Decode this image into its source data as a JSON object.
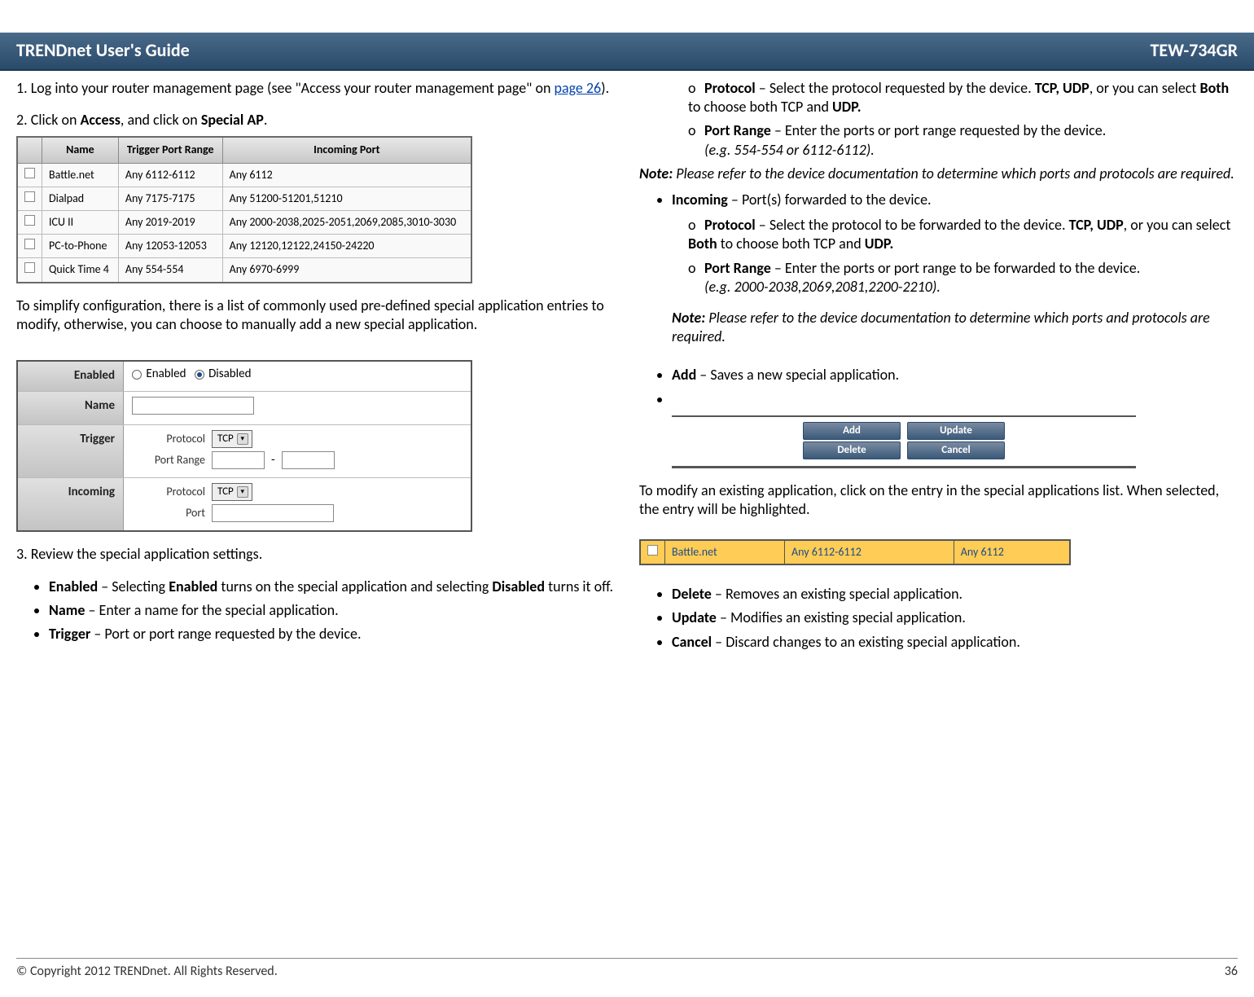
{
  "header": {
    "title_left": "TRENDnet User's Guide",
    "title_right": "TEW-734GR"
  },
  "col1": {
    "step1_a": "1. Log into your router management page (see \"Access your router management page\" on ",
    "step1_link": "page 26",
    "step1_b": ").",
    "step2_a": "2. Click on ",
    "step2_b": "Access",
    "step2_c": ", and click on ",
    "step2_d": "Special AP",
    "step2_e": ".",
    "table_headers": {
      "name": "Name",
      "trigger": "Trigger Port Range",
      "incoming": "Incoming Port"
    },
    "rows": [
      {
        "name": "Battle.net",
        "trigger": "Any 6112-6112",
        "incoming": "Any 6112"
      },
      {
        "name": "Dialpad",
        "trigger": "Any 7175-7175",
        "incoming": "Any 51200-51201,51210"
      },
      {
        "name": "ICU II",
        "trigger": "Any 2019-2019",
        "incoming": "Any 2000-2038,2025-2051,2069,2085,3010-3030"
      },
      {
        "name": "PC-to-Phone",
        "trigger": "Any 12053-12053",
        "incoming": "Any 12120,12122,24150-24220"
      },
      {
        "name": "Quick Time 4",
        "trigger": "Any 554-554",
        "incoming": "Any 6970-6999"
      }
    ],
    "simplify_text": "To simplify configuration, there is a list of commonly used pre-defined special application entries to modify, otherwise, you can choose to manually add a new special application.",
    "form": {
      "enabled_label": "Enabled",
      "enabled_opt1": "Enabled",
      "enabled_opt2": "Disabled",
      "name_label": "Name",
      "trigger_label": "Trigger",
      "protocol_label": "Protocol",
      "protocol_value": "TCP",
      "portrange_label": "Port Range",
      "incoming_label": "Incoming",
      "port_label": "Port"
    },
    "step3": "3. Review the special application settings.",
    "bullets": {
      "enabled_a": "Enabled",
      "enabled_b": " – Selecting ",
      "enabled_c": "Enabled",
      "enabled_d": " turns on the special application and selecting ",
      "enabled_e": "Disabled",
      "enabled_f": " turns it off.",
      "name_a": "Name",
      "name_b": " – Enter a name for the special application.",
      "trigger_a": "Trigger",
      "trigger_b": " – Port or port range requested by the device."
    }
  },
  "col2": {
    "sub_trigger": {
      "proto_a": "Protocol",
      "proto_b": " – Select the protocol requested by the device. ",
      "proto_c": "TCP, UDP",
      "proto_d": ", or you can select ",
      "proto_e": "Both",
      "proto_f": " to choose both TCP and ",
      "proto_g": "UDP.",
      "range_a": "Port Range",
      "range_b": " – Enter the ports or port range requested by the device.",
      "range_eg": "(e.g. 554-554 or 6112-6112)."
    },
    "note1_a": "Note:",
    "note1_b": " Please refer to the device documentation to determine which ports and protocols are required.",
    "incoming_a": "Incoming",
    "incoming_b": " – Port(s) forwarded to the device.",
    "sub_incoming": {
      "proto_a": "Protocol",
      "proto_b": " – Select the protocol to be forwarded to the device. ",
      "proto_c": "TCP, UDP",
      "proto_d": ", or you can select ",
      "proto_e": "Both",
      "proto_f": " to choose both TCP and ",
      "proto_g": "UDP.",
      "range_a": "Port Range",
      "range_b": " – Enter the ports or port range to be forwarded to the device.",
      "range_eg": "(e.g. 2000-2038,2069,2081,2200-2210)."
    },
    "note2_a": "Note:",
    "note2_b": " Please refer to the device documentation to determine which ports and protocols are required.",
    "add_a": "Add",
    "add_b": " – Saves a new special application.",
    "buttons": {
      "add": "Add",
      "update": "Update",
      "delete": "Delete",
      "cancel": "Cancel"
    },
    "modify_text": "To modify an existing application, click on the entry in the special applications list. When selected, the entry will be highlighted.",
    "hl_row": {
      "name": "Battle.net",
      "trigger": "Any 6112-6112",
      "incoming": "Any 6112"
    },
    "bullets2": {
      "delete_a": "Delete",
      "delete_b": " – Removes an existing special application.",
      "update_a": "Update",
      "update_b": " – Modifies an existing special application.",
      "cancel_a": "Cancel",
      "cancel_b": " – Discard changes to an existing special application."
    }
  },
  "footer": {
    "copyright": "© Copyright 2012 TRENDnet. All Rights Reserved.",
    "page": "36"
  }
}
